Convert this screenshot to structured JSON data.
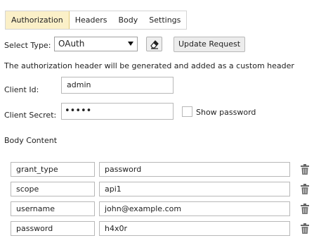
{
  "tabs": [
    {
      "label": "Authorization",
      "active": true
    },
    {
      "label": "Headers",
      "active": false
    },
    {
      "label": "Body",
      "active": false
    },
    {
      "label": "Settings",
      "active": false
    }
  ],
  "select_type": {
    "label": "Select Type:",
    "value": "OAuth"
  },
  "update_button": "Update Request",
  "info_text": "The authorization header will be generated and added as a custom header",
  "client_id": {
    "label": "Client Id:",
    "value": "admin"
  },
  "client_secret": {
    "label": "Client Secret:",
    "value": "•••••"
  },
  "show_password": {
    "label": "Show password",
    "checked": false
  },
  "body_content": {
    "label": "Body Content",
    "rows": [
      {
        "key": "grant_type",
        "value": "password"
      },
      {
        "key": "scope",
        "value": "api1"
      },
      {
        "key": "username",
        "value": "john@example.com"
      },
      {
        "key": "password",
        "value": "h4x0r"
      }
    ]
  },
  "colors": {
    "active_tab_bg": "#fbf0c8",
    "border": "#b8b8b8"
  },
  "icons": {
    "clear": "eraser-icon",
    "delete": "trash-icon",
    "dropdown": "chevron-down-icon"
  }
}
